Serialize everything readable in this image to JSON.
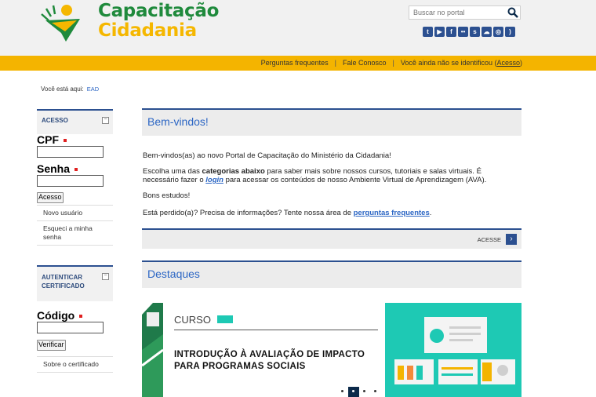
{
  "header": {
    "logo_line1": "Capacitação",
    "logo_line2": "Cidadania",
    "search_placeholder": "Buscar no portal",
    "social_icons": [
      "twitter-icon",
      "youtube-icon",
      "facebook-icon",
      "flickr-icon",
      "slideshare-icon",
      "soundcloud-icon",
      "instagram-icon",
      "rss-icon"
    ]
  },
  "topbar": {
    "faq": "Perguntas frequentes",
    "contact": "Fale Conosco",
    "not_identified": "Você ainda não se identificou (",
    "acesso": "Acesso",
    "close_paren": ")"
  },
  "breadcrumb": {
    "label": "Você está aqui:",
    "item": "EAD"
  },
  "sidebar": {
    "acesso": {
      "title": "ACESSO",
      "cpf_label": "CPF",
      "senha_label": "Senha",
      "button": "Acesso",
      "new_user": "Novo usuário",
      "forgot": "Esqueci a minha senha"
    },
    "certificado": {
      "title": "AUTENTICAR CERTIFICADO",
      "codigo_label": "Código",
      "button": "Verificar",
      "about": "Sobre o certificado"
    }
  },
  "welcome": {
    "title": "Bem-vindos!",
    "p1": "Bem-vindos(as) ao novo Portal de Capacitação do Ministério da Cidadania!",
    "p2_a": "Escolha uma das ",
    "p2_b": "categorias abaixo",
    "p2_c": " para saber mais sobre nossos cursos, tutoriais e salas virtuais. É necessário fazer o ",
    "p2_login": "login",
    "p2_d": " para acessar os conteúdos de nosso Ambiente Virtual de Aprendizagem (AVA).",
    "p3": "Bons estudos!",
    "p4_a": "Está perdido(a)? Precisa de informações? Tente nossa área de ",
    "p4_link": "perguntas frequentes",
    "p4_b": ".",
    "acesse": "ACESSE"
  },
  "destaques": {
    "title": "Destaques",
    "banner_tag": "CURSO",
    "banner_line1": "INTRODUÇÃO À AVALIAÇÃO DE IMPACTO",
    "banner_line2": "PARA PROGRAMAS SOCIAIS"
  },
  "colors": {
    "brand_green": "#1f8a3c",
    "brand_yellow": "#f4b400",
    "navy": "#2c5090",
    "link": "#2c66c4",
    "teal": "#1ec9b4"
  }
}
